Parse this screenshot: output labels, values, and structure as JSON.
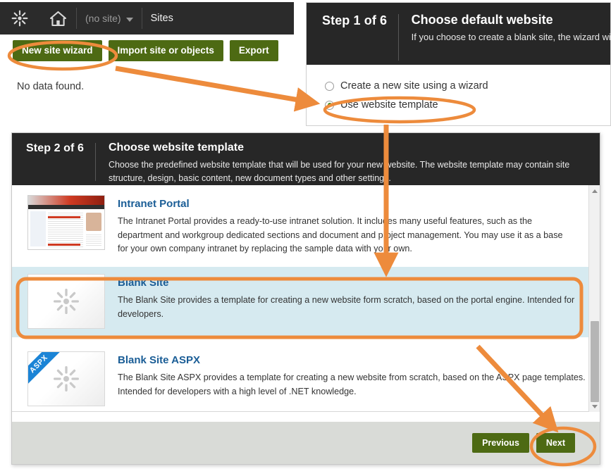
{
  "sites_window": {
    "topbar": {
      "logo_icon": "kentico-starburst-icon",
      "home_icon": "home-icon",
      "site_selector_value": "(no site)",
      "site_selector_caret": "chevron-down-icon",
      "section_label": "Sites"
    },
    "toolbar": {
      "new_site_wizard_label": "New site wizard",
      "import_label": "Import site or objects",
      "export_label": "Export"
    },
    "empty_message": "No data found."
  },
  "step1": {
    "step_label": "Step 1 of 6",
    "title": "Choose default website",
    "description": "If you choose to create a blank site, the wizard will be able to choose one of the predefined t",
    "options": [
      {
        "label": "Create a new site using a wizard",
        "selected": false
      },
      {
        "label": "Use website template",
        "selected": true
      }
    ]
  },
  "step2": {
    "step_label": "Step 2 of 6",
    "title": "Choose website template",
    "description": "Choose the predefined website template that will be used for your new website. The website template may contain site structure, design, basic content, new document types and other settings.",
    "templates": [
      {
        "name": "Intranet Portal",
        "description": "The Intranet Portal provides a ready-to-use intranet solution. It includes many useful features, such as the department and workgroup dedicated sections and document and project management. You may use it as a base for your own company intranet by replacing the sample data with your own.",
        "selected": false,
        "thumbnail": "intranet-portal-screenshot",
        "badge": ""
      },
      {
        "name": "Blank Site",
        "description": "The Blank Site provides a template for creating a new website form scratch, based on the portal engine. Intended for developers.",
        "selected": true,
        "thumbnail": "kentico-starburst-icon",
        "badge": ""
      },
      {
        "name": "Blank Site ASPX",
        "description": "The Blank Site ASPX provides a template for creating a new website from scratch, based on the ASPX page templates. Intended for developers with a high level of .NET knowledge.",
        "selected": false,
        "thumbnail": "kentico-starburst-icon",
        "badge": "ASPX"
      }
    ],
    "scrollbar": {
      "up_icon": "scroll-up-arrow-icon",
      "down_icon": "scroll-down-arrow-icon"
    },
    "footer": {
      "previous_label": "Previous",
      "next_label": "Next"
    }
  },
  "annotations": {
    "accent_color": "#ED8B3C",
    "highlights": [
      "new-site-wizard-button",
      "use-website-template-radio",
      "blank-site-row",
      "next-button"
    ],
    "arrows": [
      "new-site-wizard-to-use-website-template",
      "use-website-template-to-blank-site",
      "blank-site-to-next"
    ]
  },
  "colors": {
    "topbar_bg": "#2b2b2b",
    "wizard_header_bg": "#272727",
    "button_green": "#4d6a13",
    "link_blue": "#1a5d96",
    "selected_row_bg": "#d6eaf0",
    "footer_bg": "#d9dbd7",
    "radio_selected_green": "#2f8a19",
    "aspx_badge_blue": "#1b84d6"
  }
}
